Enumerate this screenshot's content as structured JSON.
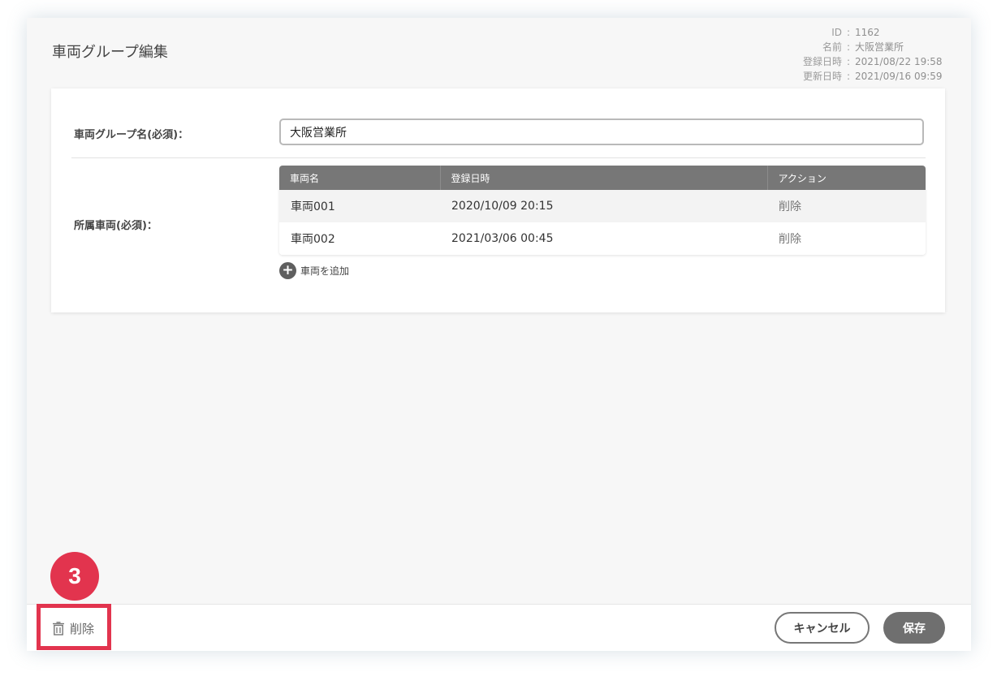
{
  "header": {
    "title": "車両グループ編集"
  },
  "meta": [
    {
      "key": "ID",
      "sep": ":",
      "value": "1162"
    },
    {
      "key": "名前",
      "sep": ":",
      "value": "大阪営業所"
    },
    {
      "key": "登録日時",
      "sep": ":",
      "value": "2021/08/22 19:58"
    },
    {
      "key": "更新日時",
      "sep": ":",
      "value": "2021/09/16 09:59"
    }
  ],
  "form": {
    "group_name_label": "車両グループ名(必須)：",
    "group_name_value": "大阪営業所",
    "vehicles_label": "所属車両(必須)：",
    "add_vehicle_label": "車両を追加"
  },
  "table": {
    "columns": [
      "車両名",
      "登録日時",
      "アクション"
    ],
    "rows": [
      {
        "name": "車両001",
        "registered": "2020/10/09 20:15",
        "action": "削除"
      },
      {
        "name": "車両002",
        "registered": "2021/03/06 00:45",
        "action": "削除"
      }
    ]
  },
  "footer": {
    "delete_label": "削除",
    "cancel_label": "キャンセル",
    "save_label": "保存"
  },
  "annotation": {
    "step_number": "3",
    "highlight_color": "#e2344e"
  },
  "icons": {
    "delete": "trash-icon",
    "add": "plus-circle-icon"
  }
}
